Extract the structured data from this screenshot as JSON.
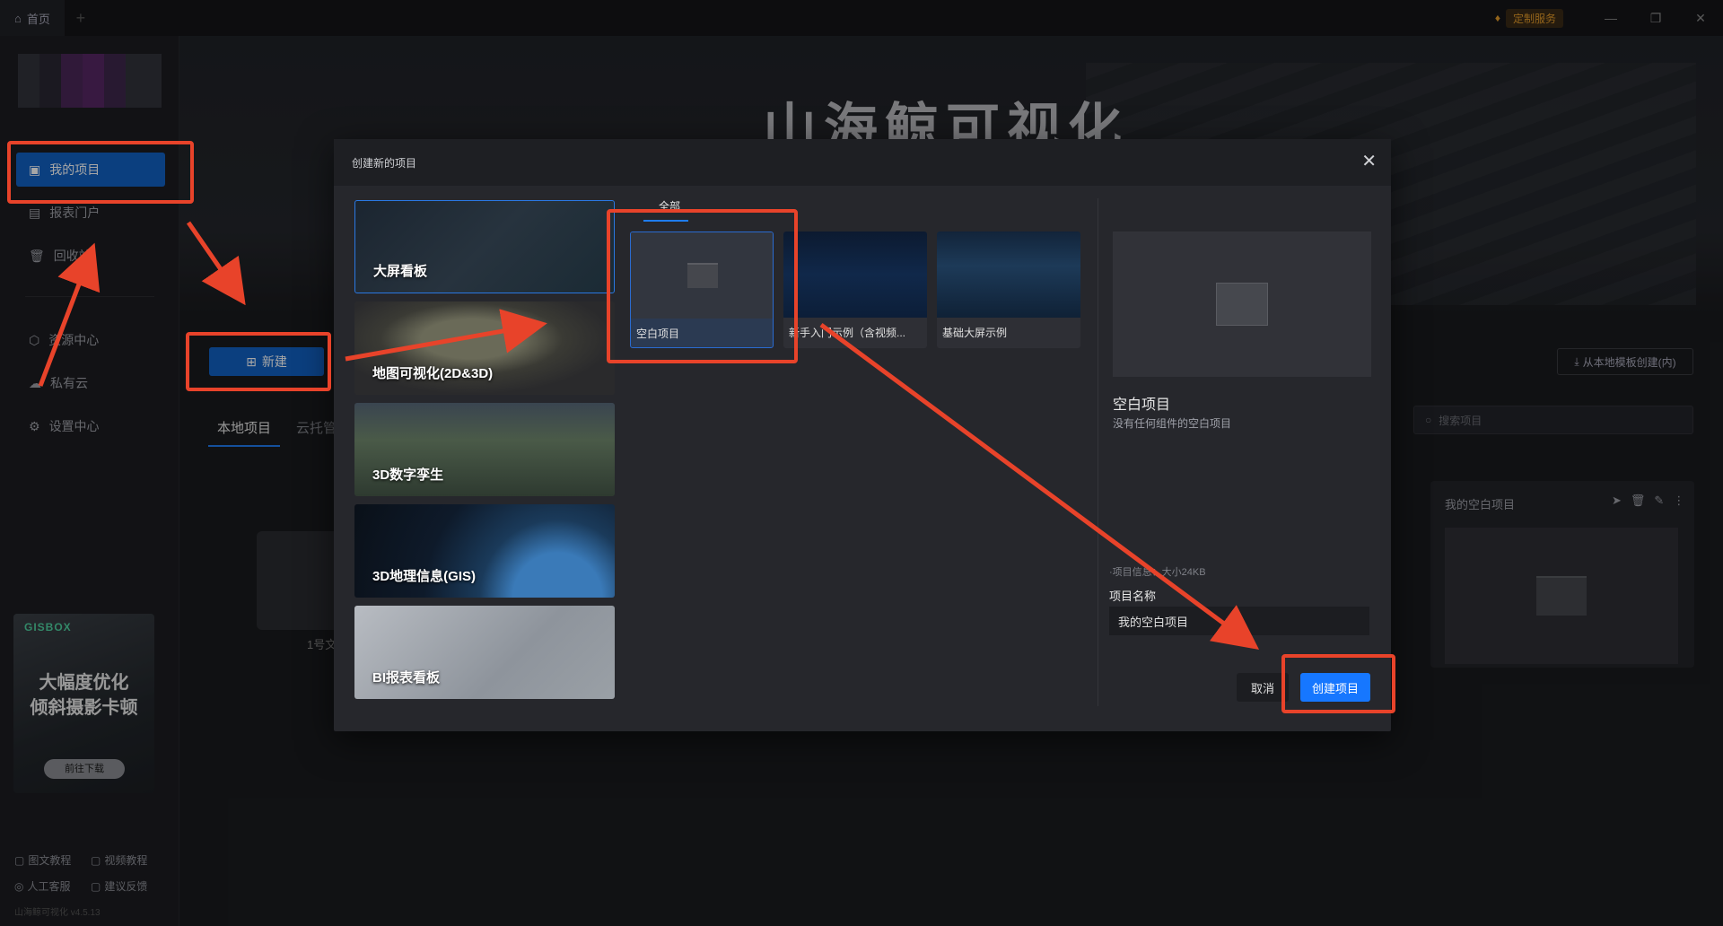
{
  "titlebar": {
    "home_tab": "首页",
    "custom_service": "定制服务"
  },
  "sidebar": {
    "items": [
      {
        "label": "我的项目",
        "icon": "projects-icon"
      },
      {
        "label": "报表门户",
        "icon": "report-icon"
      },
      {
        "label": "回收站",
        "icon": "trash-icon"
      },
      {
        "label": "资源中心",
        "icon": "resource-icon"
      },
      {
        "label": "私有云",
        "icon": "cloud-icon"
      },
      {
        "label": "设置中心",
        "icon": "settings-icon"
      }
    ],
    "promo": {
      "brand": "GISBOX",
      "line1": "大幅度优化",
      "line2": "倾斜摄影卡顿",
      "button": "前往下载"
    },
    "footer_links": [
      "图文教程",
      "视频教程",
      "人工客服",
      "建议反馈"
    ],
    "version": "山海鲸可视化 v4.5.13"
  },
  "main": {
    "hero_title": "山海鲸可视化",
    "new_button": "新建",
    "tabs": [
      "本地项目",
      "云托管"
    ],
    "local_template_button": "从本地模板创建(内)",
    "search_placeholder": "搜索项目",
    "left_card_label": "1号文",
    "right_card_title": "我的空白项目"
  },
  "modal": {
    "title": "创建新的项目",
    "categories": [
      "大屏看板",
      "地图可视化(2D&3D)",
      "3D数字孪生",
      "3D地理信息(GIS)",
      "BI报表看板"
    ],
    "filter_all": "全部",
    "templates": [
      "空白项目",
      "新手入门示例（含视频...",
      "基础大屏示例"
    ],
    "preview": {
      "title": "空白项目",
      "description": "没有任何组件的空白项目",
      "info": "·项目信息：大小24KB",
      "name_label": "项目名称",
      "name_value": "我的空白项目"
    },
    "cancel": "取消",
    "create": "创建项目"
  }
}
